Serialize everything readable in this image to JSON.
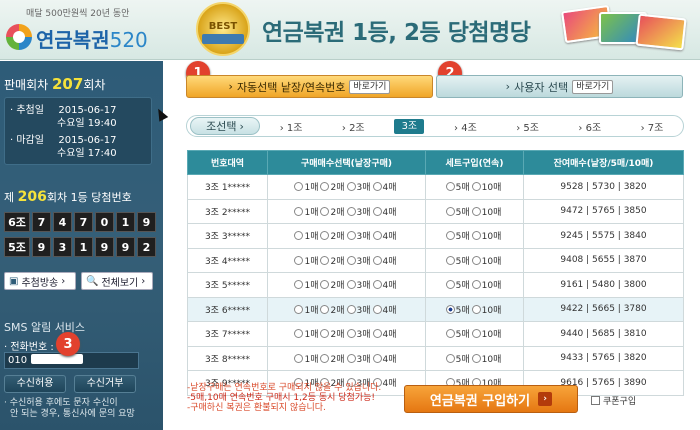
{
  "header": {
    "tagline": "매달 500만원씩 20년 동안",
    "brand": "연금복권",
    "brand_num": "520",
    "best_badge": "BEST",
    "title": "연금복권 1등, 2등 당첨명당"
  },
  "sidebar": {
    "draw_label": "판매회차",
    "draw_number": "207",
    "draw_suffix": "회차",
    "draw_date_label": "추첨일",
    "draw_date": "2015-06-17",
    "draw_time": "수요일 19:40",
    "deadline_label": "마감일",
    "deadline_date": "2015-06-17",
    "deadline_time": "수요일 17:40",
    "winning_prefix": "제",
    "winning_round": "206",
    "winning_suffix": "회차 1등 당첨번호",
    "winning_rows": [
      [
        "6조",
        "7",
        "4",
        "7",
        "0",
        "1",
        "9"
      ],
      [
        "5조",
        "9",
        "3",
        "1",
        "9",
        "9",
        "2"
      ]
    ],
    "broadcast_button": "추첨방송",
    "view_all_button": "전체보기",
    "sms_title": "SMS 알림 서비스",
    "phone_label": "· 전화번호 :",
    "phone_value": "010",
    "sms_accept": "수신허용",
    "sms_reject": "수신거부",
    "sms_note_1": "· 수신허용 후에도 문자 수신이",
    "sms_note_2": "안 되는 경우, 통신사에 문의 요망"
  },
  "badges": [
    "1",
    "2",
    "3"
  ],
  "tabs": {
    "auto_label": "자동선택 낱장/연속번호",
    "manual_label": "사용자 선택",
    "go_label": "바로가기"
  },
  "groups": {
    "label": "조선택",
    "items": [
      "1조",
      "2조",
      "3조",
      "4조",
      "5조",
      "6조",
      "7조"
    ],
    "selected": "3조"
  },
  "table": {
    "headers": [
      "번호대역",
      "구매매수선택(낱장구매)",
      "세트구입(연속)",
      "잔여매수(낱장/5매/10매)"
    ],
    "single_opts": [
      "1매",
      "2매",
      "3매",
      "4매"
    ],
    "set_opts": [
      "5매",
      "10매"
    ],
    "rows": [
      {
        "band": "3조 1*****",
        "remain": "9528 | 5730 | 3820"
      },
      {
        "band": "3조 2*****",
        "remain": "9472 | 5765 | 3850"
      },
      {
        "band": "3조 3*****",
        "remain": "9245 | 5575 | 3840"
      },
      {
        "band": "3조 4*****",
        "remain": "9408 | 5655 | 3870"
      },
      {
        "band": "3조 5*****",
        "remain": "9161 | 5480 | 3800"
      },
      {
        "band": "3조 6*****",
        "remain": "9422 | 5665 | 3780"
      },
      {
        "band": "3조 7*****",
        "remain": "9440 | 5685 | 3810"
      },
      {
        "band": "3조 8*****",
        "remain": "9433 | 5765 | 3820"
      },
      {
        "band": "3조 9*****",
        "remain": "9616 | 5765 | 3890"
      }
    ]
  },
  "notes": [
    "-낱장구매는 연속번호로 구매되지 않을 수 있습니다.",
    "-5매,10매 연속번호 구매시 1,2등 동시 당첨가능!",
    "-구매하신 복권은 환불되지 않습니다."
  ],
  "buy_button": "연금복권 구입하기",
  "coupon_label": "쿠폰구입"
}
